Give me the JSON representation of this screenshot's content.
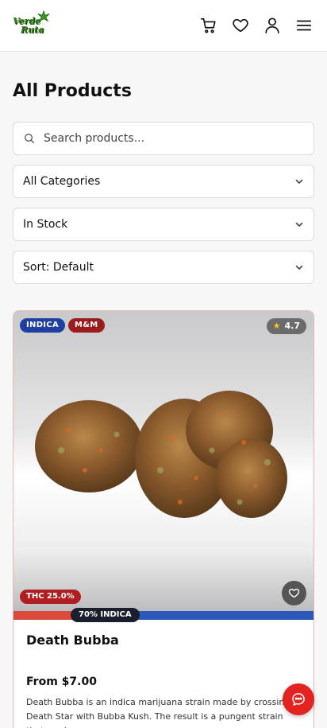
{
  "header": {
    "logo_line1": "Verde",
    "logo_line2": "Ruta",
    "icons": [
      "cart-icon",
      "heart-icon",
      "user-icon",
      "menu-icon"
    ]
  },
  "page": {
    "title": "All Products"
  },
  "search": {
    "placeholder": "Search products..."
  },
  "filters": {
    "category": "All Categories",
    "stock": "In Stock",
    "sort": "Sort: Default"
  },
  "product": {
    "badges": [
      "INDICA",
      "M&M"
    ],
    "rating": "4.7",
    "thc": "THC 25.0%",
    "strain_label": "70% INDICA",
    "strain_indica_fraction": 0.7,
    "name": "Death Bubba",
    "price": "From $7.00",
    "description": "Death Bubba is an indica marijuana strain made by crossing Death Star with Bubba Kush. The result is a pungent strain that produces"
  },
  "colors": {
    "indica_badge": "#1f3fa3",
    "mm_badge": "#9b1c1c",
    "thc_badge": "#b01f1f",
    "chat_button": "#e3231f",
    "logo_green": "#2e7d1a"
  }
}
